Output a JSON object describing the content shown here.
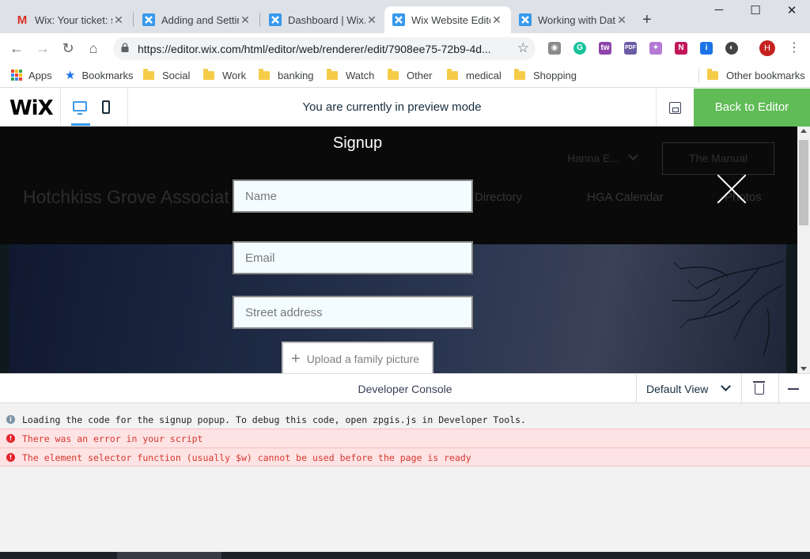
{
  "browser": {
    "tabs": [
      {
        "title": "Wix: Your ticket: s",
        "favicon": "gmail-icon"
      },
      {
        "title": "Adding and Settin",
        "favicon": "wix-icon"
      },
      {
        "title": "Dashboard | Wix.c",
        "favicon": "wix-icon"
      },
      {
        "title": "Wix Website Edito",
        "favicon": "wix-icon",
        "active": true
      },
      {
        "title": "Working with Dat",
        "favicon": "wix-icon"
      }
    ],
    "url": "https://editor.wix.com/html/editor/web/renderer/edit/7908ee75-72b9-4d...",
    "avatar_letter": "H",
    "bookmarks": [
      "Apps",
      "Bookmarks",
      "Social",
      "Work",
      "banking",
      "Watch",
      "Other",
      "medical",
      "Shopping"
    ],
    "other_bookmarks": "Other bookmarks"
  },
  "wix_bar": {
    "logo": "WiX",
    "preview_text": "You are currently in preview mode",
    "back_button": "Back to Editor",
    "accent_color": "#60bc57"
  },
  "site": {
    "title": "Hotchkiss Grove Associat",
    "nav": [
      "Directory",
      "HGA Calendar",
      "Photos"
    ],
    "member_name": "Hanna E...",
    "manual_button": "The Manual"
  },
  "popup": {
    "title": "Signup",
    "name_placeholder": "Name",
    "email_placeholder": "Email",
    "address_placeholder": "Street address",
    "upload_label": "Upload a family picture"
  },
  "console": {
    "title": "Developer Console",
    "view_select": "Default View",
    "logs": [
      {
        "level": "info",
        "text": "Loading the code for the signup popup. To debug this code, open zpgis.js in Developer Tools."
      },
      {
        "level": "error",
        "text": "There was an error in your script"
      },
      {
        "level": "error",
        "text": "The element selector function (usually $w) cannot be used before the page is ready"
      }
    ],
    "error_color": "#d6372f"
  }
}
